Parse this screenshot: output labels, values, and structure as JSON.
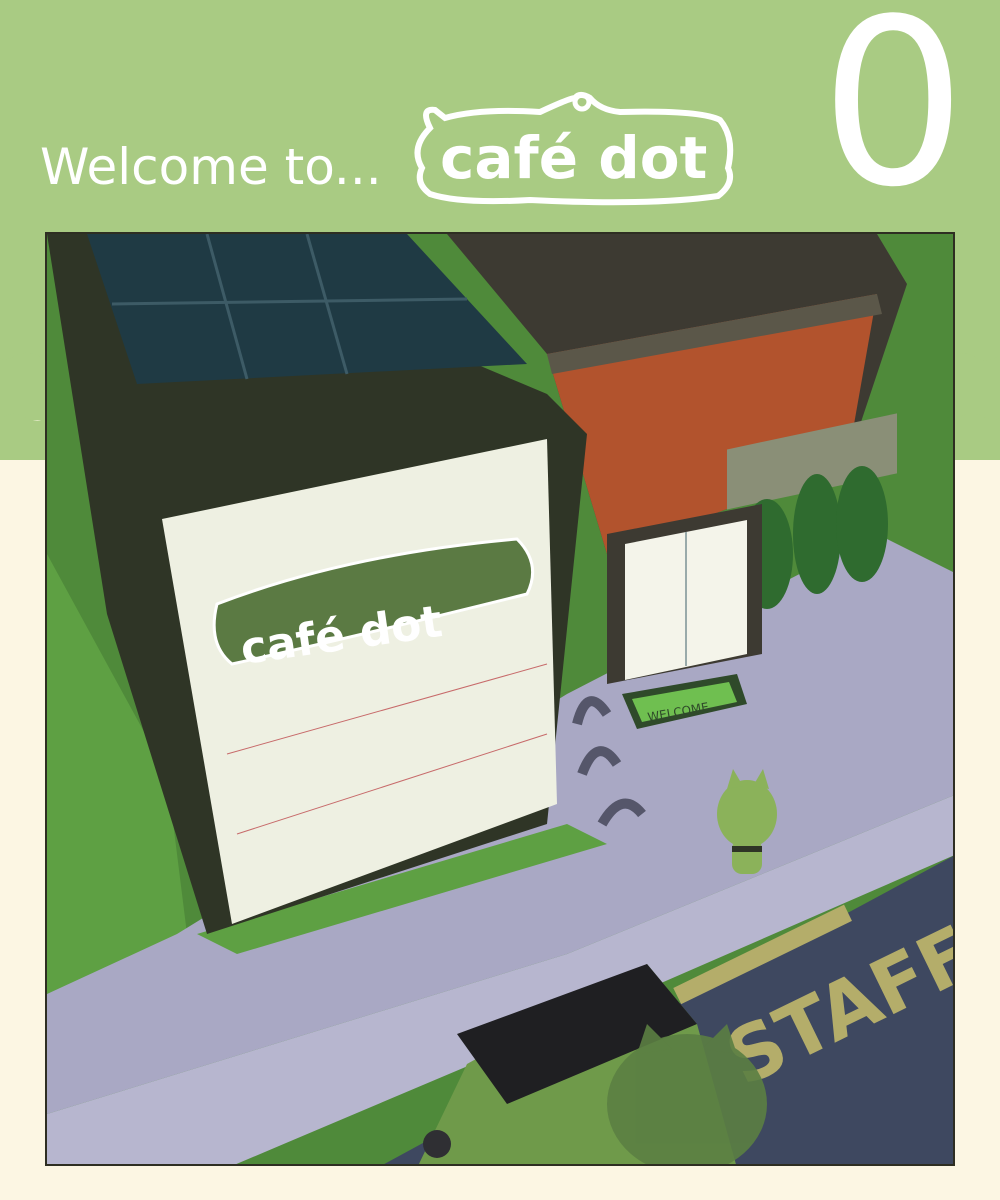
{
  "header": {
    "welcome_text": "Welcome to...",
    "logo_text": "café dot",
    "chapter_number": "0",
    "bg_color": "#a9cb83",
    "page_color": "#fcf6e3"
  },
  "scene": {
    "building_sign": "café dot",
    "doormat_text": "WELCOME",
    "parking_text": "STAFF"
  }
}
